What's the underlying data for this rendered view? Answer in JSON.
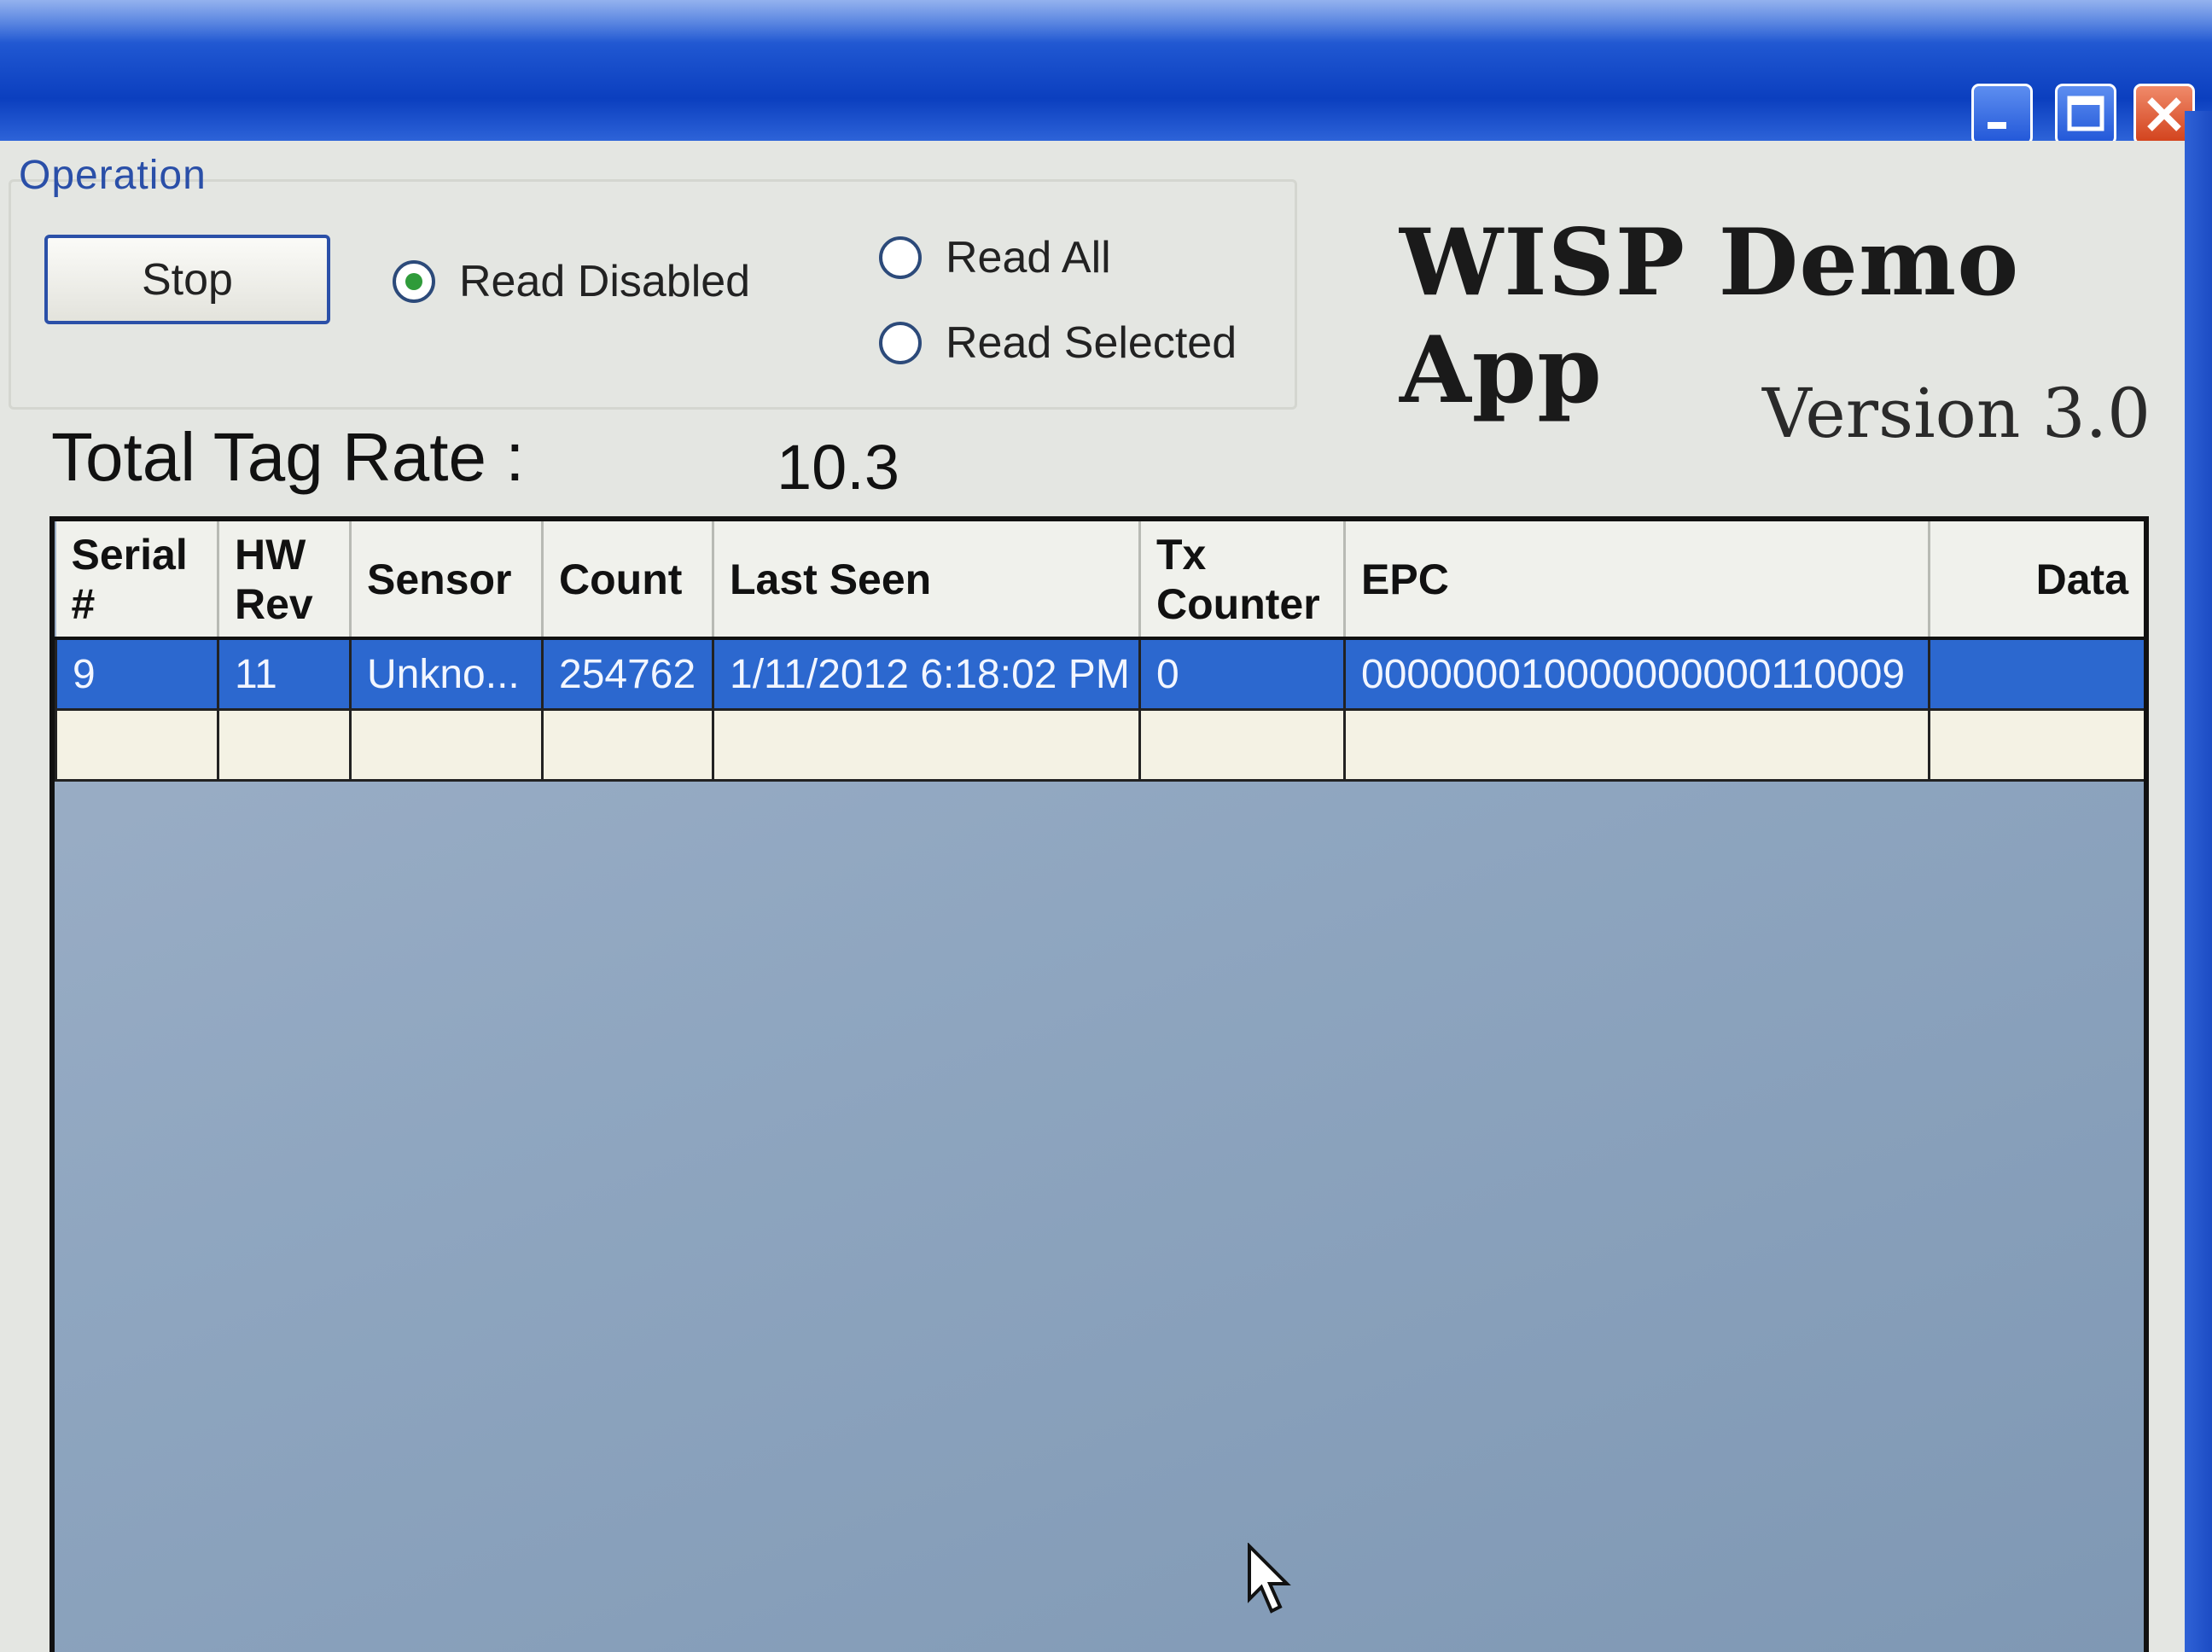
{
  "window": {
    "controls": [
      "minimize-icon",
      "maximize-icon",
      "close-icon"
    ]
  },
  "operation": {
    "group_label": "Operation",
    "stop_label": "Stop",
    "radios": {
      "read_disabled": "Read Disabled",
      "read_all": "Read All",
      "read_selected": "Read Selected"
    },
    "selected_radio": "read_disabled"
  },
  "branding": {
    "title": "WISP Demo App",
    "version": "Version 3.0"
  },
  "rate": {
    "label": "Total Tag Rate :",
    "value": "10.3"
  },
  "table": {
    "headers": {
      "serial": "Serial #",
      "hw_rev": "HW Rev",
      "sensor": "Sensor",
      "count": "Count",
      "last_seen": "Last Seen",
      "tx_counter": "Tx Counter",
      "epc": "EPC",
      "data": "Data"
    },
    "rows": [
      {
        "serial": "9",
        "hw_rev": "11",
        "sensor": "Unkno...",
        "count": "254762",
        "last_seen": "1/11/2012 6:18:02 PM",
        "tx_counter": "0",
        "epc": "000000010000000000110009",
        "data": ""
      }
    ]
  },
  "colors": {
    "titlebar": "#1e55d0",
    "selection": "#2c68cf",
    "grid_bg": "#8fa6c0"
  }
}
